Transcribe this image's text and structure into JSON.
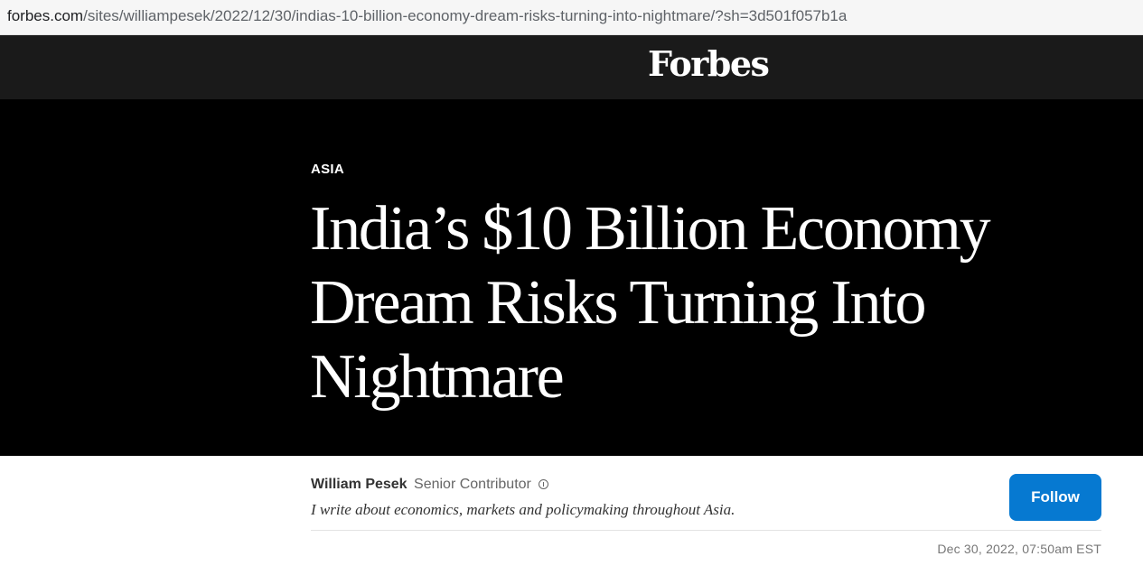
{
  "browser": {
    "url_domain": "forbes.com",
    "url_path": "/sites/williampesek/2022/12/30/indias-10-billion-economy-dream-risks-turning-into-nightmare/?sh=3d501f057b1a"
  },
  "masthead": {
    "logo": "Forbes"
  },
  "article": {
    "section": "ASIA",
    "headline": "India’s $10 Billion Economy Dream Risks Turning Into Nightmare"
  },
  "author": {
    "name": "William Pesek",
    "role": "Senior Contributor",
    "bio": "I write about economics, markets and policymaking throughout Asia.",
    "follow_label": "Follow"
  },
  "meta": {
    "timestamp": "Dec 30, 2022, 07:50am EST"
  },
  "colors": {
    "masthead_bg": "#1a1a1a",
    "hero_bg": "#000000",
    "follow_button": "#0679d1"
  }
}
